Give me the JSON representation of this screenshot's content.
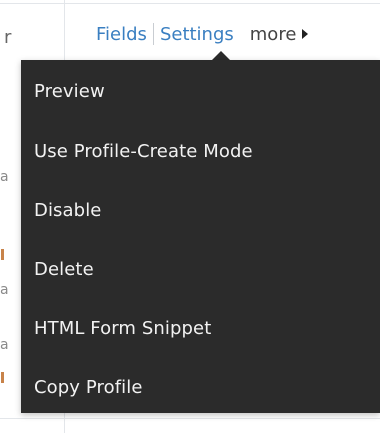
{
  "column_header_fragment": "r",
  "toolbar": {
    "fields_label": "Fields",
    "settings_label": "Settings",
    "more_label": "more"
  },
  "menu": {
    "items": [
      {
        "label": "Preview"
      },
      {
        "label": "Use Profile-Create Mode"
      },
      {
        "label": "Disable"
      },
      {
        "label": "Delete"
      },
      {
        "label": "HTML Form Snippet"
      },
      {
        "label": "Copy Profile"
      }
    ]
  },
  "background_fragments": [
    "a",
    "a",
    "a"
  ],
  "colors": {
    "link": "#3a7fc1",
    "menu_background": "#2b2b2b",
    "menu_text": "#f2f2f2"
  }
}
